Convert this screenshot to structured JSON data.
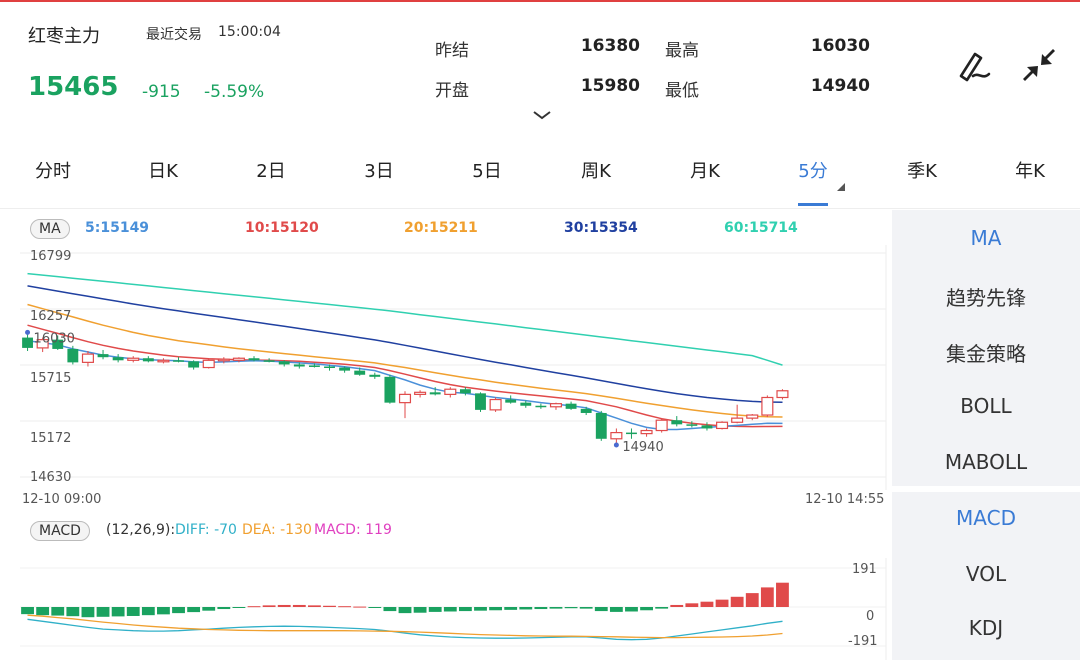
{
  "header": {
    "title": "红枣主力",
    "trade_label": "最近交易",
    "trade_time": "15:00:04",
    "price": "15465",
    "change": "-915",
    "change_pct": "-5.59%",
    "prev_settle_label": "昨结",
    "prev_settle": "16380",
    "high_label": "最高",
    "high": "16030",
    "open_label": "开盘",
    "open": "15980",
    "low_label": "最低",
    "low": "14940",
    "up_color": "#e04a4a",
    "down_color": "#1aa260"
  },
  "tabs": [
    {
      "label": "分时"
    },
    {
      "label": "日K"
    },
    {
      "label": "2日"
    },
    {
      "label": "3日"
    },
    {
      "label": "5日"
    },
    {
      "label": "周K"
    },
    {
      "label": "月K"
    },
    {
      "label": "5分"
    },
    {
      "label": "季K"
    },
    {
      "label": "年K"
    }
  ],
  "active_tab": 7,
  "ma_bar": {
    "badge": "MA",
    "ma5": "5:15149",
    "ma10": "10:15120",
    "ma20": "20:15211",
    "ma30": "30:15354",
    "ma60": "60:15714",
    "colors": {
      "ma5": "#4a90d9",
      "ma10": "#e04a4a",
      "ma20": "#f0a030",
      "ma30": "#2040a0",
      "ma60": "#30d0b0"
    }
  },
  "kline": {
    "y_ticks": [
      "16799",
      "16257",
      "15715",
      "15172",
      "14630"
    ],
    "high_mark": "16030",
    "low_mark": "14940",
    "start_time": "12-10 09:00",
    "end_time": "12-10 14:55"
  },
  "macd_bar": {
    "badge": "MACD",
    "params": "(12,26,9):",
    "diff": "DIFF: -70",
    "dea": "DEA: -130",
    "macd": "MACD: 119",
    "y_ticks": [
      "191",
      "0",
      "-191"
    ]
  },
  "side_top": [
    {
      "label": "MA",
      "active": true
    },
    {
      "label": "趋势先锋",
      "active": false
    },
    {
      "label": "集金策略",
      "active": false
    },
    {
      "label": "BOLL",
      "active": false
    },
    {
      "label": "MABOLL",
      "active": false
    }
  ],
  "side_bottom": [
    {
      "label": "MACD",
      "active": true
    },
    {
      "label": "VOL",
      "active": false
    },
    {
      "label": "KDJ",
      "active": false
    }
  ],
  "chart_data": {
    "type": "candlestick",
    "y_range": [
      14630,
      16799
    ],
    "candles": [
      {
        "o": 15980,
        "h": 16030,
        "l": 15850,
        "c": 15880
      },
      {
        "o": 15880,
        "h": 15980,
        "l": 15840,
        "c": 15960
      },
      {
        "o": 15960,
        "h": 16000,
        "l": 15860,
        "c": 15870
      },
      {
        "o": 15870,
        "h": 15900,
        "l": 15720,
        "c": 15740
      },
      {
        "o": 15740,
        "h": 15850,
        "l": 15700,
        "c": 15820
      },
      {
        "o": 15820,
        "h": 15860,
        "l": 15770,
        "c": 15790
      },
      {
        "o": 15790,
        "h": 15820,
        "l": 15740,
        "c": 15760
      },
      {
        "o": 15760,
        "h": 15800,
        "l": 15740,
        "c": 15780
      },
      {
        "o": 15780,
        "h": 15800,
        "l": 15740,
        "c": 15750
      },
      {
        "o": 15750,
        "h": 15780,
        "l": 15730,
        "c": 15760
      },
      {
        "o": 15760,
        "h": 15790,
        "l": 15740,
        "c": 15750
      },
      {
        "o": 15750,
        "h": 15760,
        "l": 15670,
        "c": 15690
      },
      {
        "o": 15690,
        "h": 15780,
        "l": 15680,
        "c": 15760
      },
      {
        "o": 15760,
        "h": 15790,
        "l": 15730,
        "c": 15770
      },
      {
        "o": 15760,
        "h": 15790,
        "l": 15740,
        "c": 15780
      },
      {
        "o": 15780,
        "h": 15800,
        "l": 15750,
        "c": 15760
      },
      {
        "o": 15760,
        "h": 15780,
        "l": 15740,
        "c": 15750
      },
      {
        "o": 15750,
        "h": 15760,
        "l": 15700,
        "c": 15720
      },
      {
        "o": 15720,
        "h": 15740,
        "l": 15680,
        "c": 15700
      },
      {
        "o": 15710,
        "h": 15730,
        "l": 15690,
        "c": 15700
      },
      {
        "o": 15700,
        "h": 15720,
        "l": 15660,
        "c": 15690
      },
      {
        "o": 15690,
        "h": 15700,
        "l": 15640,
        "c": 15660
      },
      {
        "o": 15660,
        "h": 15690,
        "l": 15610,
        "c": 15620
      },
      {
        "o": 15620,
        "h": 15640,
        "l": 15580,
        "c": 15600
      },
      {
        "o": 15600,
        "h": 15620,
        "l": 15340,
        "c": 15350
      },
      {
        "o": 15350,
        "h": 15460,
        "l": 15200,
        "c": 15430
      },
      {
        "o": 15430,
        "h": 15470,
        "l": 15400,
        "c": 15450
      },
      {
        "o": 15450,
        "h": 15500,
        "l": 15420,
        "c": 15430
      },
      {
        "o": 15430,
        "h": 15500,
        "l": 15400,
        "c": 15480
      },
      {
        "o": 15480,
        "h": 15500,
        "l": 15420,
        "c": 15440
      },
      {
        "o": 15440,
        "h": 15450,
        "l": 15260,
        "c": 15280
      },
      {
        "o": 15280,
        "h": 15400,
        "l": 15260,
        "c": 15380
      },
      {
        "o": 15380,
        "h": 15420,
        "l": 15340,
        "c": 15350
      },
      {
        "o": 15350,
        "h": 15370,
        "l": 15300,
        "c": 15320
      },
      {
        "o": 15320,
        "h": 15340,
        "l": 15290,
        "c": 15310
      },
      {
        "o": 15310,
        "h": 15350,
        "l": 15280,
        "c": 15340
      },
      {
        "o": 15340,
        "h": 15360,
        "l": 15280,
        "c": 15290
      },
      {
        "o": 15290,
        "h": 15310,
        "l": 15230,
        "c": 15250
      },
      {
        "o": 15250,
        "h": 15270,
        "l": 14980,
        "c": 15000
      },
      {
        "o": 15000,
        "h": 15100,
        "l": 14940,
        "c": 15060
      },
      {
        "o": 15060,
        "h": 15100,
        "l": 15000,
        "c": 15050
      },
      {
        "o": 15050,
        "h": 15100,
        "l": 15020,
        "c": 15080
      },
      {
        "o": 15080,
        "h": 15200,
        "l": 15060,
        "c": 15180
      },
      {
        "o": 15180,
        "h": 15220,
        "l": 15120,
        "c": 15140
      },
      {
        "o": 15140,
        "h": 15170,
        "l": 15110,
        "c": 15130
      },
      {
        "o": 15130,
        "h": 15160,
        "l": 15080,
        "c": 15100
      },
      {
        "o": 15100,
        "h": 15170,
        "l": 15090,
        "c": 15160
      },
      {
        "o": 15160,
        "h": 15330,
        "l": 15150,
        "c": 15200
      },
      {
        "o": 15200,
        "h": 15240,
        "l": 15180,
        "c": 15230
      },
      {
        "o": 15230,
        "h": 15420,
        "l": 15210,
        "c": 15400
      },
      {
        "o": 15400,
        "h": 15480,
        "l": 15380,
        "c": 15465
      }
    ],
    "ma5": [
      15950,
      15930,
      15910,
      15870,
      15840,
      15810,
      15790,
      15775,
      15765,
      15760,
      15755,
      15745,
      15740,
      15745,
      15750,
      15755,
      15752,
      15745,
      15735,
      15725,
      15712,
      15698,
      15680,
      15660,
      15615,
      15570,
      15520,
      15480,
      15450,
      15440,
      15420,
      15400,
      15385,
      15370,
      15350,
      15335,
      15320,
      15300,
      15250,
      15200,
      15150,
      15110,
      15090,
      15090,
      15100,
      15110,
      15120,
      15130,
      15140,
      15150,
      15149
    ],
    "ma10": [
      16100,
      16060,
      16020,
      15980,
      15940,
      15905,
      15875,
      15850,
      15830,
      15810,
      15795,
      15785,
      15775,
      15770,
      15765,
      15762,
      15760,
      15756,
      15750,
      15742,
      15733,
      15722,
      15708,
      15690,
      15660,
      15625,
      15590,
      15555,
      15525,
      15500,
      15480,
      15462,
      15445,
      15430,
      15415,
      15400,
      15385,
      15370,
      15340,
      15310,
      15270,
      15230,
      15195,
      15170,
      15150,
      15135,
      15125,
      15120,
      15118,
      15119,
      15120
    ],
    "ma20": [
      16300,
      16260,
      16220,
      16180,
      16140,
      16100,
      16065,
      16030,
      16000,
      15975,
      15950,
      15930,
      15910,
      15890,
      15872,
      15856,
      15840,
      15825,
      15810,
      15795,
      15780,
      15765,
      15750,
      15735,
      15712,
      15690,
      15665,
      15640,
      15615,
      15592,
      15570,
      15548,
      15528,
      15508,
      15490,
      15472,
      15455,
      15438,
      15415,
      15392,
      15368,
      15345,
      15322,
      15300,
      15280,
      15262,
      15245,
      15230,
      15220,
      15213,
      15211
    ],
    "ma30": [
      16480,
      16455,
      16430,
      16405,
      16380,
      16355,
      16330,
      16305,
      16282,
      16260,
      16238,
      16216,
      16195,
      16174,
      16153,
      16132,
      16111,
      16090,
      16068,
      16046,
      16024,
      16002,
      15980,
      15958,
      15932,
      15905,
      15878,
      15850,
      15822,
      15795,
      15768,
      15742,
      15716,
      15690,
      15665,
      15640,
      15615,
      15590,
      15563,
      15536,
      15510,
      15485,
      15460,
      15438,
      15418,
      15400,
      15385,
      15372,
      15362,
      15356,
      15354
    ],
    "ma60": [
      16600,
      16585,
      16570,
      16555,
      16540,
      16525,
      16510,
      16495,
      16480,
      16465,
      16450,
      16435,
      16420,
      16405,
      16390,
      16375,
      16360,
      16345,
      16330,
      16315,
      16300,
      16285,
      16270,
      16255,
      16238,
      16220,
      16202,
      16184,
      16166,
      16148,
      16130,
      16112,
      16094,
      16076,
      16058,
      16040,
      16022,
      16004,
      15986,
      15968,
      15950,
      15932,
      15914,
      15896,
      15878,
      15860,
      15842,
      15824,
      15806,
      15760,
      15714
    ],
    "macd_range": [
      -191,
      191
    ],
    "macd_hist": [
      -35,
      -40,
      -42,
      -45,
      -50,
      -48,
      -46,
      -44,
      -40,
      -36,
      -30,
      -25,
      -18,
      -10,
      -4,
      4,
      8,
      10,
      10,
      8,
      6,
      4,
      2,
      -2,
      -20,
      -30,
      -28,
      -24,
      -22,
      -20,
      -18,
      -16,
      -14,
      -12,
      -10,
      -8,
      -6,
      -8,
      -20,
      -24,
      -22,
      -16,
      -8,
      10,
      18,
      26,
      36,
      50,
      68,
      96,
      119
    ],
    "macd_diff": [
      -60,
      -70,
      -80,
      -90,
      -100,
      -108,
      -112,
      -116,
      -118,
      -118,
      -116,
      -112,
      -108,
      -104,
      -100,
      -97,
      -95,
      -94,
      -95,
      -97,
      -100,
      -103,
      -106,
      -110,
      -118,
      -128,
      -136,
      -142,
      -147,
      -150,
      -152,
      -153,
      -153,
      -152,
      -150,
      -148,
      -146,
      -146,
      -152,
      -158,
      -160,
      -158,
      -152,
      -142,
      -132,
      -122,
      -112,
      -102,
      -92,
      -80,
      -70
    ],
    "macd_dea": [
      -40,
      -45,
      -52,
      -58,
      -66,
      -74,
      -81,
      -88,
      -94,
      -99,
      -104,
      -107,
      -110,
      -112,
      -114,
      -115,
      -116,
      -116,
      -116,
      -116,
      -116,
      -116,
      -117,
      -118,
      -119,
      -121,
      -123,
      -126,
      -129,
      -132,
      -135,
      -137,
      -139,
      -141,
      -142,
      -143,
      -143,
      -144,
      -145,
      -146,
      -148,
      -149,
      -150,
      -150,
      -149,
      -148,
      -147,
      -145,
      -142,
      -137,
      -130
    ]
  }
}
